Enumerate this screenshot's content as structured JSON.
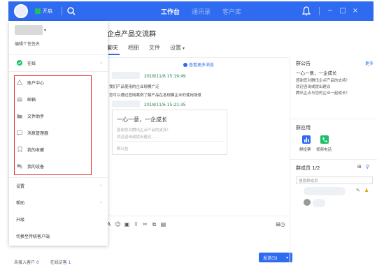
{
  "topbar": {
    "open_label": "开启",
    "tabs": [
      {
        "label": "工作台",
        "active": true
      },
      {
        "label": "通讯录",
        "active": false
      },
      {
        "label": "客户库",
        "active": false
      }
    ],
    "minimize_label": "−",
    "maximize_label": "□",
    "close_label": "×"
  },
  "chat": {
    "title": "企点产品交流群",
    "tabs": [
      "聊天",
      "相册",
      "文件",
      "设置"
    ],
    "more_messages": "查看更多消息",
    "messages": [
      {
        "time": "2018/11/6 15:19:49",
        "lines": [
          "我们产品使用的企业规模广泛",
          "您可以通过官网案例了解产品在各规模企业的使用场景"
        ]
      },
      {
        "time": "2018/11/6 15:21:35"
      }
    ],
    "card": {
      "title": "一心一意，一企成长",
      "line1": "感谢您对腾讯企点产品的支持！",
      "line2": "欢迎咨询或提出建议...",
      "footer": "群公告"
    },
    "send_label": "发送(S)"
  },
  "right_panel": {
    "announcement_title": "群公告",
    "announcement_more": "更多",
    "announcement_headline": "一心一意，一企成长",
    "announcement_lines": [
      "感谢您对腾讯企点产品的支持！",
      "欢迎咨询或提出建议",
      "腾讯企点与您的企业一起成长！"
    ],
    "apps_title": "群应用",
    "apps": [
      {
        "label": "群投票",
        "color": "#2f6bf0"
      },
      {
        "label": "视频电话",
        "color": "#1fbf6a"
      }
    ],
    "members_title": "群成员 1/2",
    "member_search_placeholder": "搜索群成员"
  },
  "status_bar": {
    "unconnected_label": "未接入客户",
    "unconnected_count": "0",
    "online_label": "在线访客",
    "online_count": "1"
  },
  "menu": {
    "signature": "编辑个性签名",
    "online_status": "在线",
    "items": [
      {
        "label": "账户中心",
        "icon": "warning-icon"
      },
      {
        "label": "邮箱",
        "icon": "mail-icon"
      },
      {
        "label": "文件助手",
        "icon": "folder-icon"
      },
      {
        "label": "消息管理器",
        "icon": "message-icon"
      },
      {
        "label": "我的收藏",
        "icon": "bookmark-icon"
      },
      {
        "label": "我的设备",
        "icon": "device-icon"
      }
    ],
    "settings": "设置",
    "help": "帮助",
    "upgrade": "升级",
    "switch_client": "切换至传统客户端"
  }
}
